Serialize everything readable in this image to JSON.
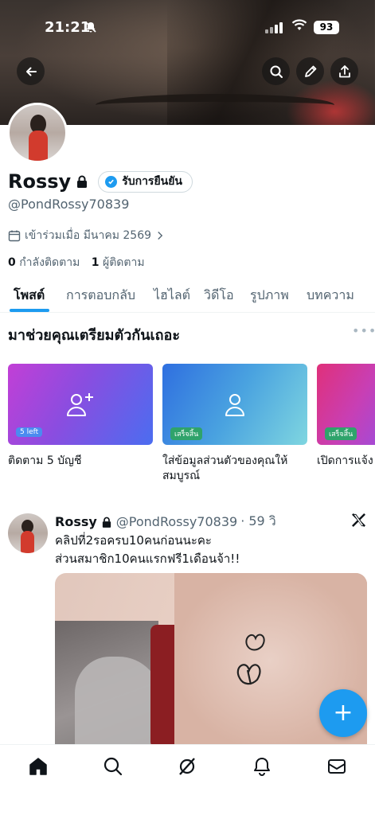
{
  "status_bar": {
    "time": "21:21",
    "battery": "93"
  },
  "profile": {
    "name": "Rossy",
    "verify_label": "รับการยืนยัน",
    "handle": "@PondRossy70839",
    "joined": "เข้าร่วมเมื่อ มีนาคม 2569",
    "following_count": "0",
    "following_label": "กำลังติดตาม",
    "followers_count": "1",
    "followers_label": "ผู้ติดตาม"
  },
  "tabs": [
    "โพสต์",
    "การตอบกลับ",
    "ไฮไลต์",
    "วิดีโอ",
    "รูปภาพ",
    "บทความ"
  ],
  "onboarding": {
    "title": "มาช่วยคุณเตรียมตัวกันเถอะ",
    "cards": [
      {
        "tag": "5 left",
        "label": "ติดตาม 5 บัญชี",
        "icon": "follow-user-icon"
      },
      {
        "tag": "เสร็จสิ้น",
        "label": "ใส่ข้อมูลส่วนตัวของคุณให้สมบูรณ์",
        "icon": "profile-user-icon"
      },
      {
        "tag": "เสร็จสิ้น",
        "label": "เปิดการแจ้ง",
        "icon": ""
      }
    ]
  },
  "tweet": {
    "name": "Rossy",
    "handle": "@PondRossy70839",
    "time": "· 59 วิ",
    "text_line1": "คลิปที่2รอครบ10คนก่อนนะคะ",
    "text_line2": "ส่วนสมาชิก10คนแรกฟรี1เดือนจ้า!!"
  },
  "fab_label": "+",
  "colors": {
    "accent": "#1d9bf0",
    "text": "#0f1419",
    "muted": "#536471"
  }
}
